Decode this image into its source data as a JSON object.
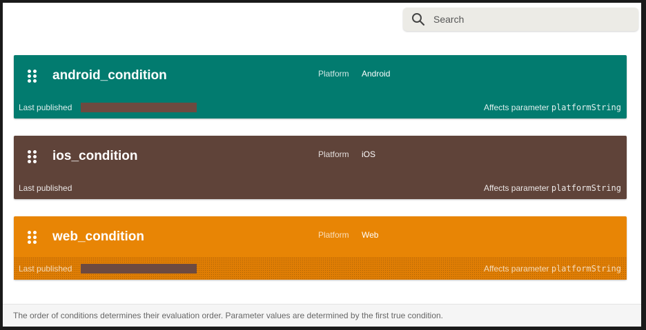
{
  "search": {
    "placeholder": "Search",
    "icon": "search-icon"
  },
  "conditions": [
    {
      "name": "android_condition",
      "color": "#027b6f",
      "rule_label": "Platform",
      "rule_value": "Android",
      "last_published_label": "Last published",
      "last_published_redacted": true,
      "affects_label": "Affects parameter",
      "affects_param": "platformString"
    },
    {
      "name": "ios_condition",
      "color": "#5f4339",
      "rule_label": "Platform",
      "rule_value": "iOS",
      "last_published_label": "Last published",
      "last_published_redacted": false,
      "affects_label": "Affects parameter",
      "affects_param": "platformString"
    },
    {
      "name": "web_condition",
      "color": "#e88505",
      "rule_label": "Platform",
      "rule_value": "Web",
      "last_published_label": "Last published",
      "last_published_redacted": true,
      "affects_label": "Affects parameter",
      "affects_param": "platformString"
    }
  ],
  "footer": {
    "note": "The order of conditions determines their evaluation order. Parameter values are determined by the first true condition."
  }
}
